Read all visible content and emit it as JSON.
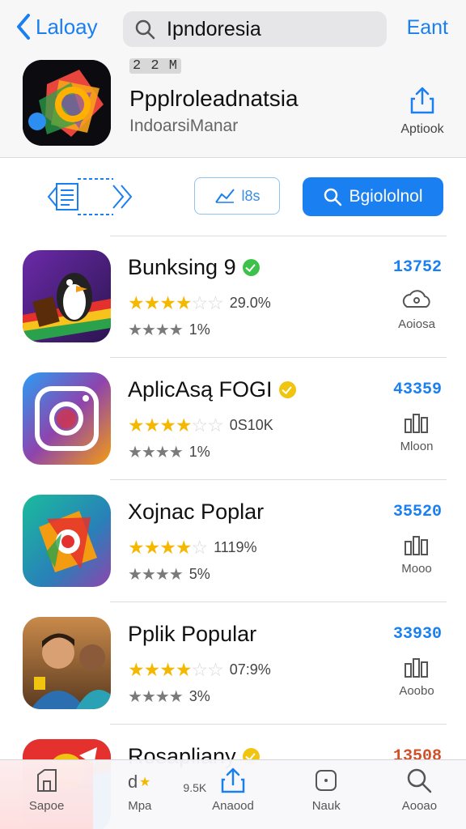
{
  "header": {
    "back_label": "Laloay",
    "search_value": "Ipndoresia",
    "edit_label": "Eant"
  },
  "featured": {
    "badge": "2 2 M",
    "title": "Ppplroleadnatsia",
    "subtitle": "IndoarsiManar",
    "share_label": "Aptiook"
  },
  "toolbar": {
    "secondary_label": "l8s",
    "primary_label": "Bgiololnol"
  },
  "apps": [
    {
      "name": "Bunksing 9",
      "verified_color": "#3cc24a",
      "rating_pct": "29.0%",
      "rating_stars": 4,
      "count": "1%",
      "price": "13752",
      "price_color": "#1a7ff0",
      "action_label": "Aoiosa",
      "action_icon": "cloud-icon"
    },
    {
      "name": "AplicAsą FOGI",
      "verified_color": "#f1c40f",
      "rating_pct": "0S10K",
      "rating_stars": 4,
      "count": "1%",
      "price": "43359",
      "price_color": "#1a7ff0",
      "action_label": "Mloon",
      "action_icon": "bar-chart-icon"
    },
    {
      "name": "Xojnac Poplar",
      "verified_color": "",
      "rating_pct": "1119%",
      "rating_stars": 4,
      "count": "5%",
      "price": "35520",
      "price_color": "#1a7ff0",
      "action_label": "Mooo",
      "action_icon": "bar-chart-icon"
    },
    {
      "name": "Pplik Popular",
      "verified_color": "",
      "rating_pct": "07:9%",
      "rating_stars": 4,
      "count": "3%",
      "price": "33930",
      "price_color": "#1a7ff0",
      "action_label": "Aoobo",
      "action_icon": "bar-chart-icon"
    },
    {
      "name": "Rosapliany",
      "verified_color": "#f1c40f",
      "price": "13508",
      "price_color": "#d0502a"
    }
  ],
  "tabs": [
    {
      "label": "Sapoe",
      "icon": "store-icon"
    },
    {
      "label": "Mpa",
      "icon": "rating-icon",
      "extra": "9.5K"
    },
    {
      "label": "Anaood",
      "icon": "upload-icon"
    },
    {
      "label": "Nauk",
      "icon": "box-icon"
    },
    {
      "label": "Aooao",
      "icon": "search-icon"
    }
  ],
  "colors": {
    "accent": "#1a7ff0",
    "star": "#f5b800",
    "star_empty": "#d8d8d8"
  }
}
